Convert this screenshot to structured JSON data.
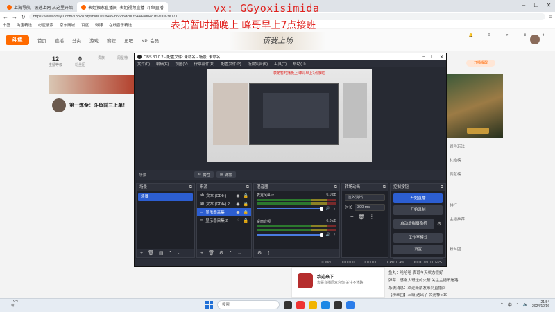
{
  "browser": {
    "tabs": [
      {
        "label": "上海导航 - 极速上网 从这里开始"
      },
      {
        "label": "表姐独家直播间_表姐视频直播_斗鱼直播"
      }
    ],
    "url": "https://www.douyu.com/13828?dyshid=160f4a5-b56b5dcb0f5446ad04c1f6c0063e171",
    "bookmarks": [
      "书签",
      "淘宝精选",
      "必应搜索",
      "京东商城",
      "百度",
      "微博",
      "在线音乐精选"
    ]
  },
  "watermark": {
    "line1": "vx: GGyoxisimida",
    "line2": "表弟暂时播晚上 峰哥早上7点接班"
  },
  "douyu": {
    "logo": "斗鱼",
    "nav": [
      "首页",
      "直播",
      "分类",
      "游戏",
      "赛程",
      "鱼吧",
      "KPI 会员"
    ],
    "banner": "该我上场",
    "stats": [
      {
        "value": "12",
        "label": "主播等级"
      },
      {
        "value": "0",
        "label": "粉丝团"
      },
      {
        "value": "",
        "label": "贵族"
      },
      {
        "value": "",
        "label": "周星榜"
      }
    ],
    "room_title": "第一炼金：斗鱼前三上单！",
    "right_tag": "开播提醒",
    "right_texts": [
      "冒险玩法",
      "礼物榜",
      "贡献榜",
      "排行",
      "主播推荐",
      "粉丝团"
    ],
    "bottom_card": {
      "name": "欢迎来下",
      "sub": "表哥直播间欢迎你 关注不迷路"
    },
    "chat_lines": [
      "鱼丸：哈哈哈 表哥今天状态很好",
      "弹幕：感谢大哥送的火箭 关注主播不迷路",
      "系统消息：欢迎新朋友来到直播间",
      "【粉丝团】三级 送出了 荧光棒 x10"
    ]
  },
  "obs": {
    "title": "OBS 30.0.2 - 配置文件: 未命名 - 场景: 未命名",
    "menu": [
      "文件(F)",
      "编辑(E)",
      "视图(V)",
      "停靠部件(D)",
      "配置文件(P)",
      "场景集合(S)",
      "工具(T)",
      "帮助(H)"
    ],
    "preview_note": "表弟暂时播晚上 峰哥早上7点接班",
    "scenebar": {
      "current": "场景",
      "properties": "属性",
      "filters": "滤镜"
    },
    "docks": {
      "scenes": {
        "title": "场景",
        "items": [
          "场景"
        ]
      },
      "sources": {
        "title": "来源",
        "items": [
          "文本 (GDI+)",
          "文本 (GDI+) 2",
          "显示器采集",
          "显示器采集 2"
        ]
      },
      "mixer": {
        "title": "混音器",
        "channels": [
          {
            "name": "麦克风/Aux",
            "db": "0.0 dB",
            "level": 0.92
          },
          {
            "name": "桌面音频",
            "db": "0.0 dB",
            "level": 0.92
          }
        ]
      },
      "transitions": {
        "title": "转场动画",
        "type": "淡入淡出",
        "duration_label": "时长",
        "duration": "300 ms"
      },
      "controls": {
        "title": "控制按钮",
        "buttons": [
          "开始直播",
          "开始录制",
          "启动虚拟摄像机",
          "工作室模式",
          "设置",
          "退出"
        ]
      }
    },
    "status": [
      "0 kb/s",
      "00:00:00",
      "00:00:00",
      "CPU: 0.4%",
      "60.00 / 60.00 FPS"
    ]
  },
  "taskbar": {
    "weather": "19°C",
    "weather_sub": "晴",
    "search": "搜索",
    "tray_lang": "中",
    "time": "21:54",
    "date": "2024/10/16"
  },
  "colors": {
    "accent_red": "#e0201c",
    "douyu_orange": "#ff6a00",
    "obs_bg": "#272a33",
    "obs_blue": "#2c5ed1"
  }
}
